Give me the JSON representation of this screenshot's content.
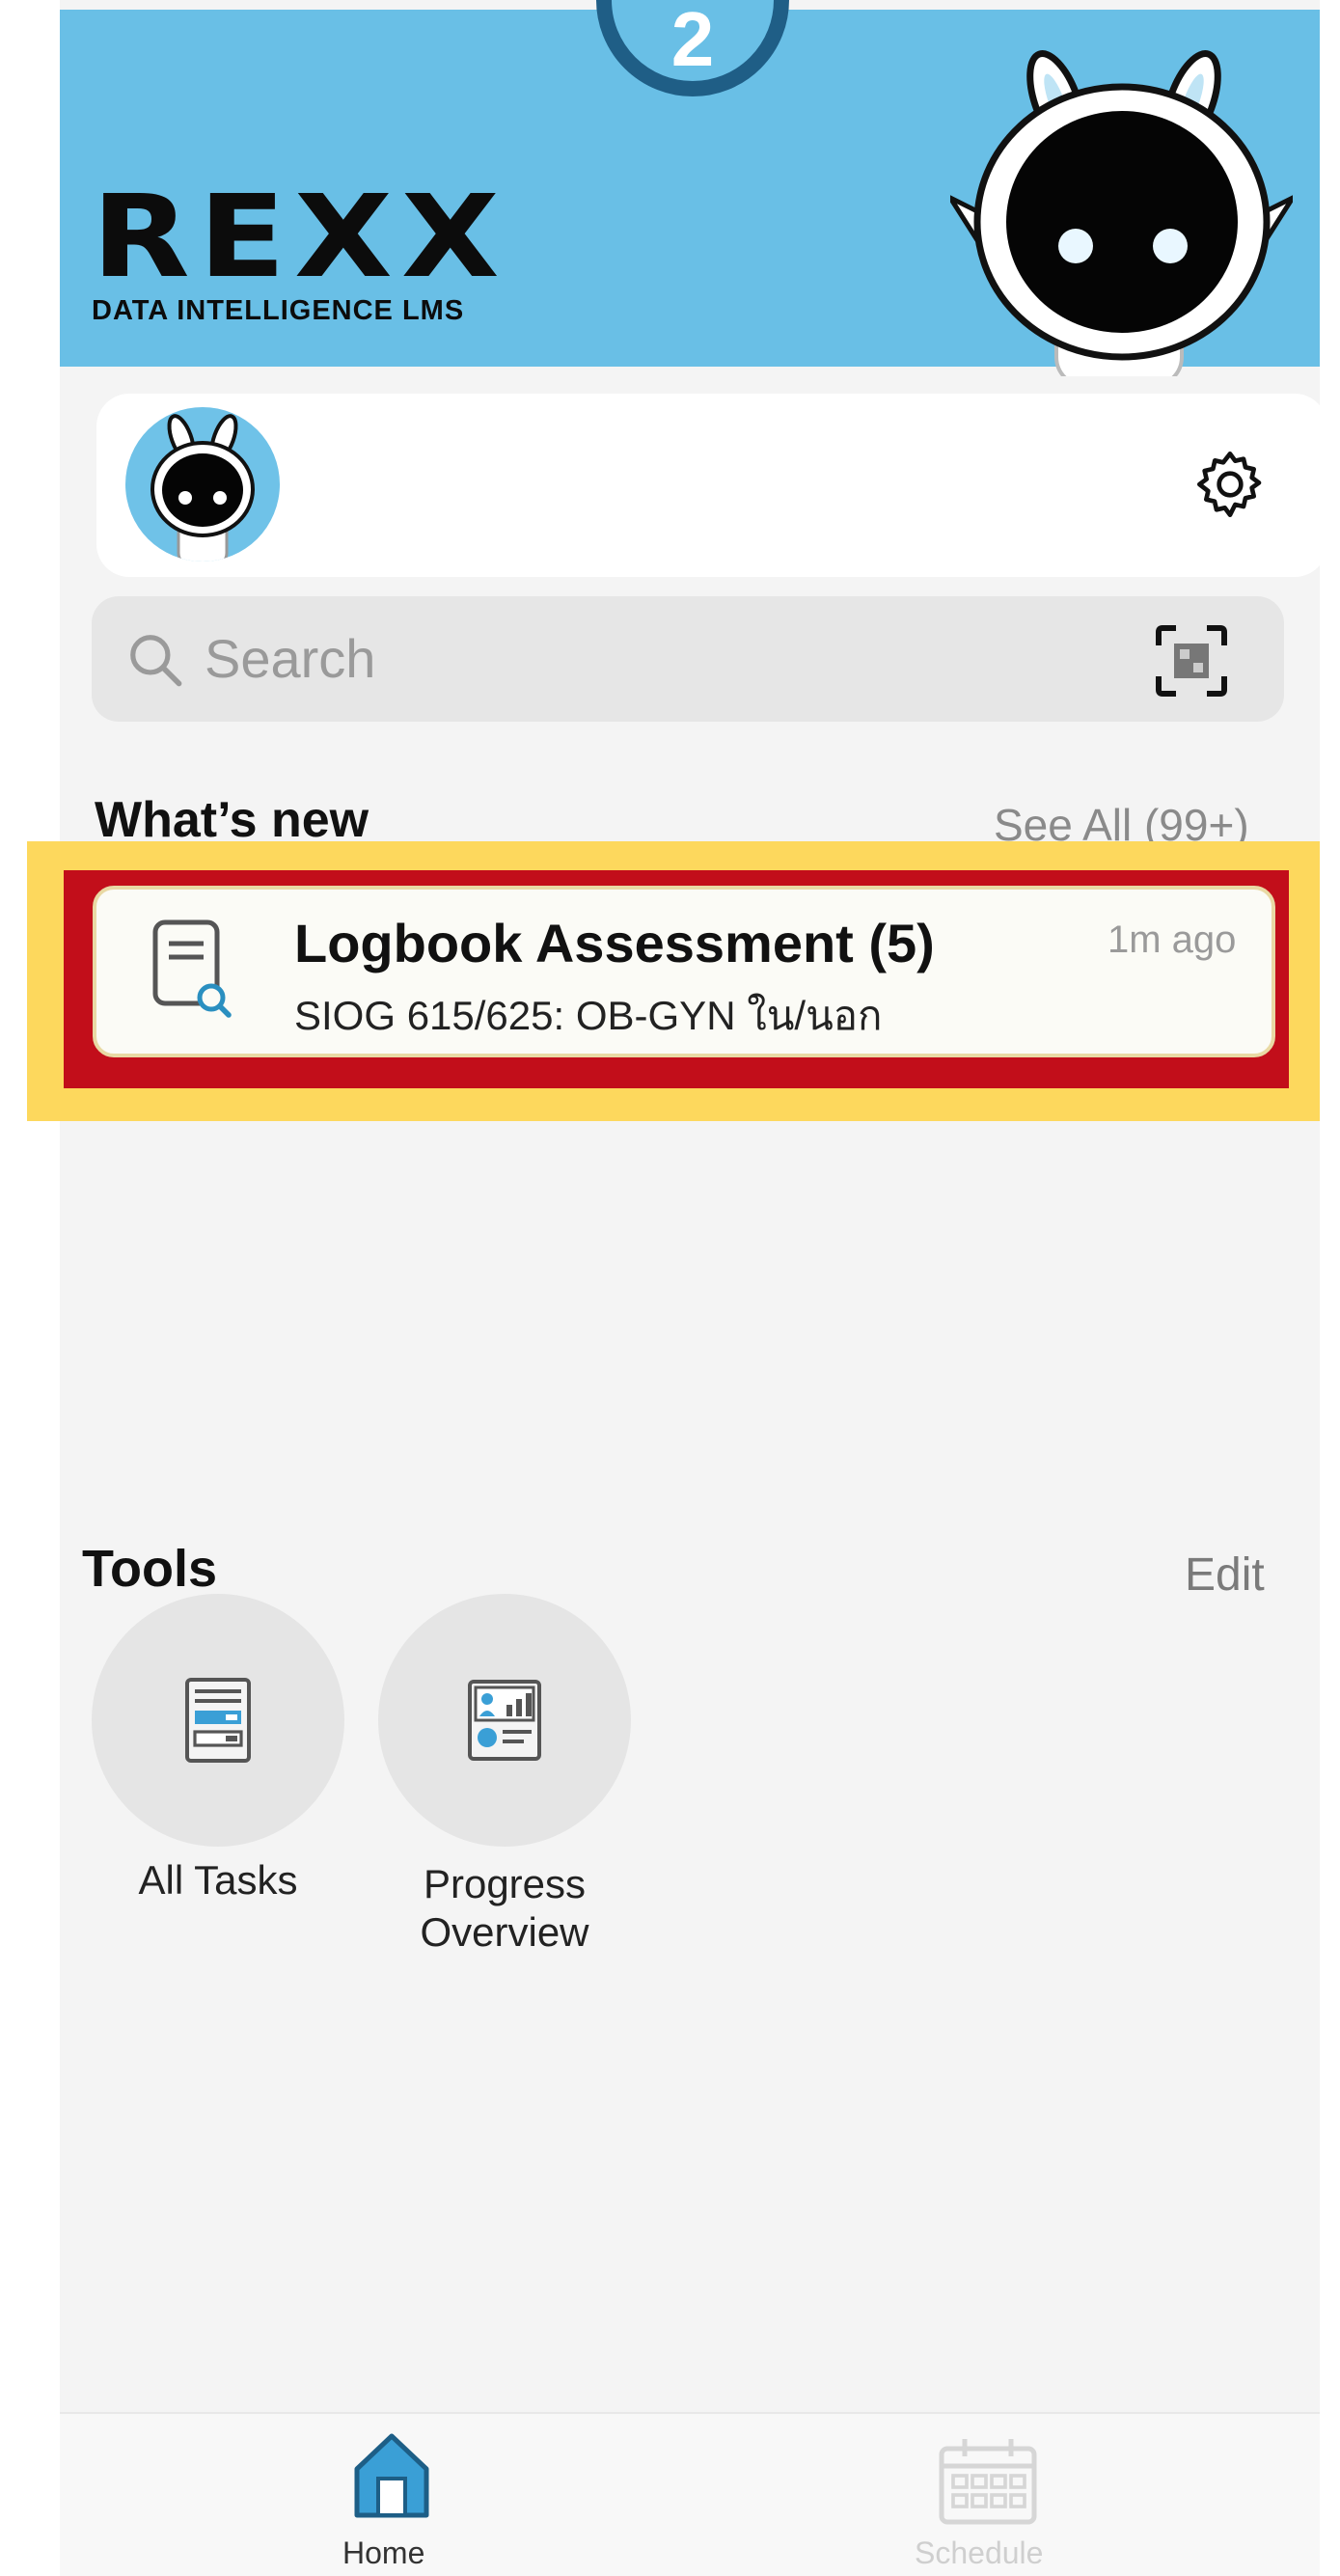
{
  "step_badge": "2",
  "header": {
    "logo_text": "REXX",
    "logo_subtitle": "DATA INTELLIGENCE LMS"
  },
  "search": {
    "placeholder": "Search"
  },
  "whats_new": {
    "title": "What’s new",
    "see_all_label": "See All (99+)",
    "items": [
      {
        "title": "Logbook Assessment (5)",
        "subtitle": "SIOG 615/625: OB-GYN ใน/นอก",
        "time": "1m ago"
      }
    ]
  },
  "tools": {
    "title": "Tools",
    "edit_label": "Edit",
    "items": [
      {
        "label": "All Tasks",
        "icon": "all-tasks-icon"
      },
      {
        "label": "Progress Overview",
        "icon": "progress-overview-icon"
      }
    ]
  },
  "tabbar": {
    "tabs": [
      {
        "label": "Home",
        "icon": "home-icon",
        "active": true
      },
      {
        "label": "Schedule",
        "icon": "calendar-icon",
        "active": false
      }
    ]
  },
  "colors": {
    "header_bg": "#69bfe6",
    "highlight_outer": "#fdd85d",
    "highlight_inner": "#c20e1a",
    "step_badge": "#1f5e86"
  }
}
